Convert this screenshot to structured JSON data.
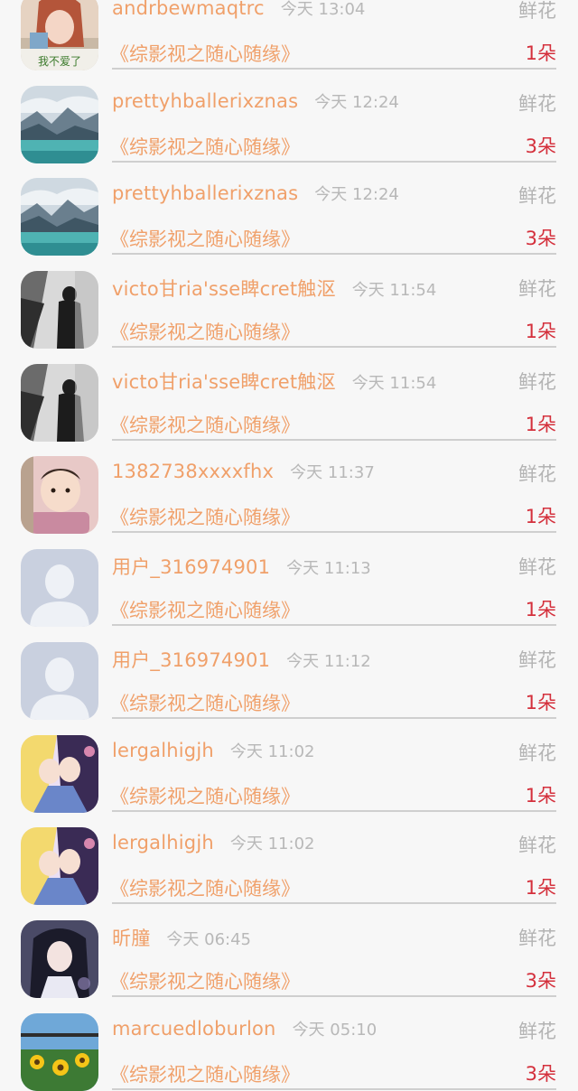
{
  "list": {
    "rows": [
      {
        "name": "andrbewmaqtrc",
        "time": "今天 13:04",
        "gift": "鲜花",
        "title": "《综影视之随心随缘》",
        "count": "1朵",
        "avatar": "girl-photo"
      },
      {
        "name": "prettyhballerixznas",
        "time": "今天 12:24",
        "gift": "鲜花",
        "title": "《综影视之随心随缘》",
        "count": "3朵",
        "avatar": "lake-landscape"
      },
      {
        "name": "prettyhballerixznas",
        "time": "今天 12:24",
        "gift": "鲜花",
        "title": "《综影视之随心随缘》",
        "count": "3朵",
        "avatar": "lake-landscape"
      },
      {
        "name": "victo甘ria'sse睥cret触沤",
        "time": "今天 11:54",
        "gift": "鲜花",
        "title": "《综影视之随心随缘》",
        "count": "1朵",
        "avatar": "snow-figure"
      },
      {
        "name": "victo甘ria'sse睥cret触沤",
        "time": "今天 11:54",
        "gift": "鲜花",
        "title": "《综影视之随心随缘》",
        "count": "1朵",
        "avatar": "snow-figure"
      },
      {
        "name": "1382738xxxxfhx",
        "time": "今天 11:37",
        "gift": "鲜花",
        "title": "《综影视之随心随缘》",
        "count": "1朵",
        "avatar": "baby-photo"
      },
      {
        "name": "用户_316974901",
        "time": "今天 11:13",
        "gift": "鲜花",
        "title": "《综影视之随心随缘》",
        "count": "1朵",
        "avatar": "default-user"
      },
      {
        "name": "用户_316974901",
        "time": "今天 11:12",
        "gift": "鲜花",
        "title": "《综影视之随心随缘》",
        "count": "1朵",
        "avatar": "default-user"
      },
      {
        "name": "lergalhigjh",
        "time": "今天 11:02",
        "gift": "鲜花",
        "title": "《综影视之随心随缘》",
        "count": "1朵",
        "avatar": "anime-couple"
      },
      {
        "name": "lergalhigjh",
        "time": "今天 11:02",
        "gift": "鲜花",
        "title": "《综影视之随心随缘》",
        "count": "1朵",
        "avatar": "anime-couple"
      },
      {
        "name": "昕朣",
        "time": "今天 06:45",
        "gift": "鲜花",
        "title": "《综影视之随心随缘》",
        "count": "3朵",
        "avatar": "anime-girl"
      },
      {
        "name": "marcuedloburlon",
        "time": "今天 05:10",
        "gift": "鲜花",
        "title": "《综影视之随心随缘》",
        "count": "3朵",
        "avatar": "sunflowers"
      }
    ],
    "avatar_overlay_text": "我不爱了"
  },
  "colors": {
    "name": "#f0a06a",
    "title": "#f0a06a",
    "count": "#d4303c",
    "gift": "#b3b3b3",
    "time": "#b8b8b8",
    "background": "#f7f7f7"
  }
}
